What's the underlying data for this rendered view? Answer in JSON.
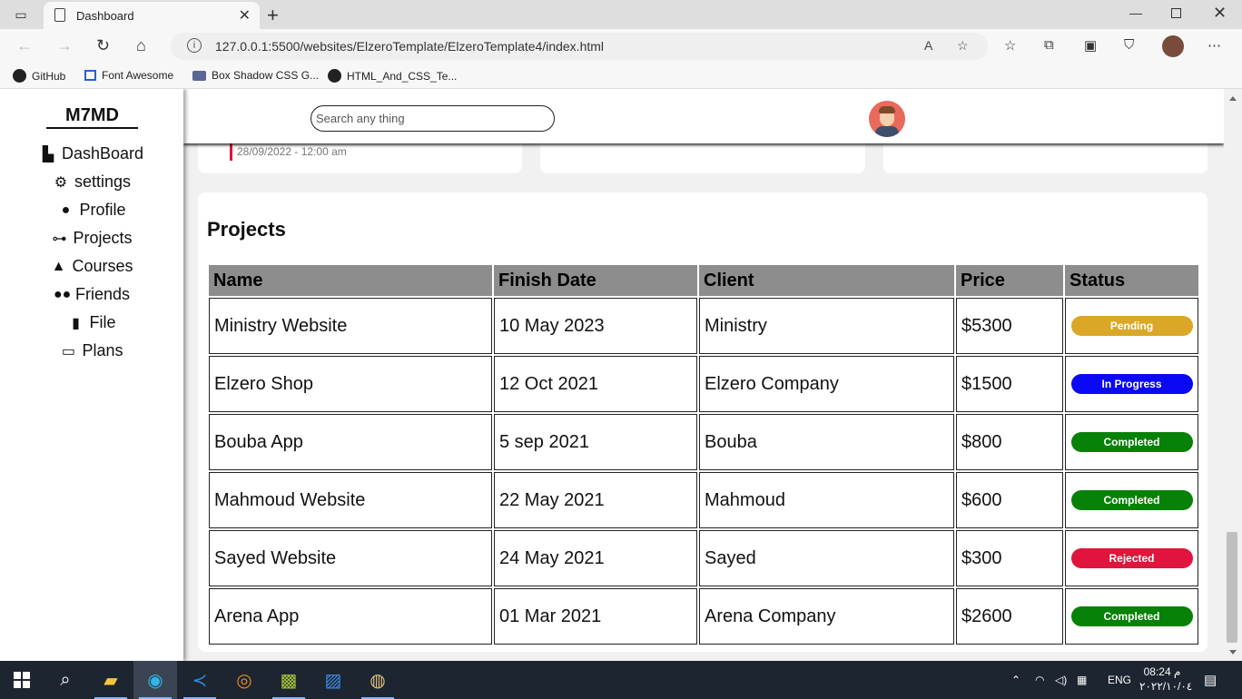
{
  "browser": {
    "tab_title": "Dashboard",
    "url": "127.0.0.1:5500/websites/ElzeroTemplate/ElzeroTemplate4/index.html",
    "bookmarks": [
      "GitHub",
      "Font Awesome",
      "Box Shadow CSS G...",
      "HTML_And_CSS_Te..."
    ]
  },
  "sidebar": {
    "logo": "M7MD",
    "items": [
      {
        "label": "DashBoard",
        "icon": "chart-icon"
      },
      {
        "label": "settings",
        "icon": "gear-icon"
      },
      {
        "label": "Profile",
        "icon": "user-icon"
      },
      {
        "label": "Projects",
        "icon": "diagram-icon"
      },
      {
        "label": "Courses",
        "icon": "graduation-cap-icon"
      },
      {
        "label": "Friends",
        "icon": "users-icon"
      },
      {
        "label": "File",
        "icon": "file-icon"
      },
      {
        "label": "Plans",
        "icon": "credit-card-icon"
      }
    ]
  },
  "header": {
    "search_placeholder": "Search any thing"
  },
  "top_card": {
    "date": "28/09/2022 - 12:00 am"
  },
  "projects": {
    "title": "Projects",
    "columns": [
      "Name",
      "Finish Date",
      "Client",
      "Price",
      "Status"
    ],
    "rows": [
      {
        "name": "Ministry Website",
        "date": "10 May 2023",
        "client": "Ministry",
        "price": "$5300",
        "status": "Pending"
      },
      {
        "name": "Elzero Shop",
        "date": "12 Oct 2021",
        "client": "Elzero Company",
        "price": "$1500",
        "status": "In Progress"
      },
      {
        "name": "Bouba App",
        "date": "5 sep 2021",
        "client": "Bouba",
        "price": "$800",
        "status": "Completed"
      },
      {
        "name": "Mahmoud Website",
        "date": "22 May 2021",
        "client": "Mahmoud",
        "price": "$600",
        "status": "Completed"
      },
      {
        "name": "Sayed Website",
        "date": "24 May 2021",
        "client": "Sayed",
        "price": "$300",
        "status": "Rejected"
      },
      {
        "name": "Arena App",
        "date": "01 Mar 2021",
        "client": "Arena Company",
        "price": "$2600",
        "status": "Completed"
      }
    ]
  },
  "status_colors": {
    "Pending": "#dba726",
    "In Progress": "#0a08f4",
    "Completed": "#088108",
    "Rejected": "#e0143c"
  },
  "taskbar": {
    "lang": "ENG",
    "time": "08:24 م",
    "date": "٢٠٢٢/١٠/٠٤"
  }
}
